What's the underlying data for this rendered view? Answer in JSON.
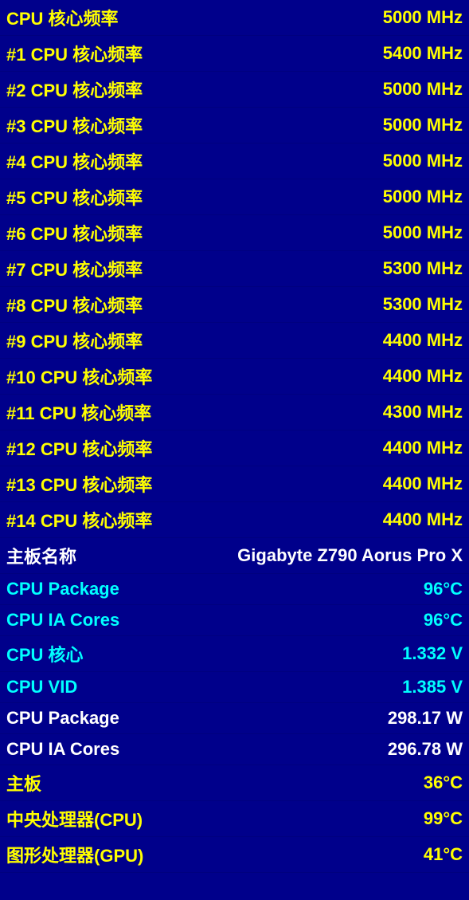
{
  "rows": [
    {
      "id": "cpu-core-freq",
      "label": "CPU 核心频率",
      "value": "5000 MHz",
      "color": "yellow"
    },
    {
      "id": "cpu-core-freq-1",
      "label": "#1 CPU 核心频率",
      "value": "5400 MHz",
      "color": "yellow"
    },
    {
      "id": "cpu-core-freq-2",
      "label": "#2 CPU 核心频率",
      "value": "5000 MHz",
      "color": "yellow"
    },
    {
      "id": "cpu-core-freq-3",
      "label": "#3 CPU 核心频率",
      "value": "5000 MHz",
      "color": "yellow"
    },
    {
      "id": "cpu-core-freq-4",
      "label": "#4 CPU 核心频率",
      "value": "5000 MHz",
      "color": "yellow"
    },
    {
      "id": "cpu-core-freq-5",
      "label": "#5 CPU 核心频率",
      "value": "5000 MHz",
      "color": "yellow"
    },
    {
      "id": "cpu-core-freq-6",
      "label": "#6 CPU 核心频率",
      "value": "5000 MHz",
      "color": "yellow"
    },
    {
      "id": "cpu-core-freq-7",
      "label": "#7 CPU 核心频率",
      "value": "5300 MHz",
      "color": "yellow"
    },
    {
      "id": "cpu-core-freq-8",
      "label": "#8 CPU 核心频率",
      "value": "5300 MHz",
      "color": "yellow"
    },
    {
      "id": "cpu-core-freq-9",
      "label": "#9 CPU 核心频率",
      "value": "4400 MHz",
      "color": "yellow"
    },
    {
      "id": "cpu-core-freq-10",
      "label": "#10 CPU 核心频率",
      "value": "4400 MHz",
      "color": "yellow"
    },
    {
      "id": "cpu-core-freq-11",
      "label": "#11 CPU 核心频率",
      "value": "4300 MHz",
      "color": "yellow"
    },
    {
      "id": "cpu-core-freq-12",
      "label": "#12 CPU 核心频率",
      "value": "4400 MHz",
      "color": "yellow"
    },
    {
      "id": "cpu-core-freq-13",
      "label": "#13 CPU 核心频率",
      "value": "4400 MHz",
      "color": "yellow"
    },
    {
      "id": "cpu-core-freq-14",
      "label": "#14 CPU 核心频率",
      "value": "4400 MHz",
      "color": "yellow"
    },
    {
      "id": "motherboard-name",
      "label": "主板名称",
      "value": "Gigabyte Z790 Aorus Pro X",
      "color": "white"
    },
    {
      "id": "cpu-package-temp",
      "label": "CPU Package",
      "value": "96°C",
      "color": "cyan"
    },
    {
      "id": "cpu-ia-cores-temp",
      "label": "CPU IA Cores",
      "value": "96°C",
      "color": "cyan"
    },
    {
      "id": "cpu-core-voltage",
      "label": "CPU 核心",
      "value": "1.332 V",
      "color": "cyan"
    },
    {
      "id": "cpu-vid",
      "label": "CPU VID",
      "value": "1.385 V",
      "color": "cyan"
    },
    {
      "id": "cpu-package-power",
      "label": "CPU Package",
      "value": "298.17 W",
      "color": "white"
    },
    {
      "id": "cpu-ia-cores-power",
      "label": "CPU IA Cores",
      "value": "296.78 W",
      "color": "white"
    },
    {
      "id": "motherboard-temp",
      "label": "主板",
      "value": "36°C",
      "color": "yellow"
    },
    {
      "id": "cpu-temp",
      "label": "中央处理器(CPU)",
      "value": "99°C",
      "color": "yellow"
    },
    {
      "id": "gpu-temp",
      "label": "图形处理器(GPU)",
      "value": "41°C",
      "color": "yellow"
    }
  ]
}
